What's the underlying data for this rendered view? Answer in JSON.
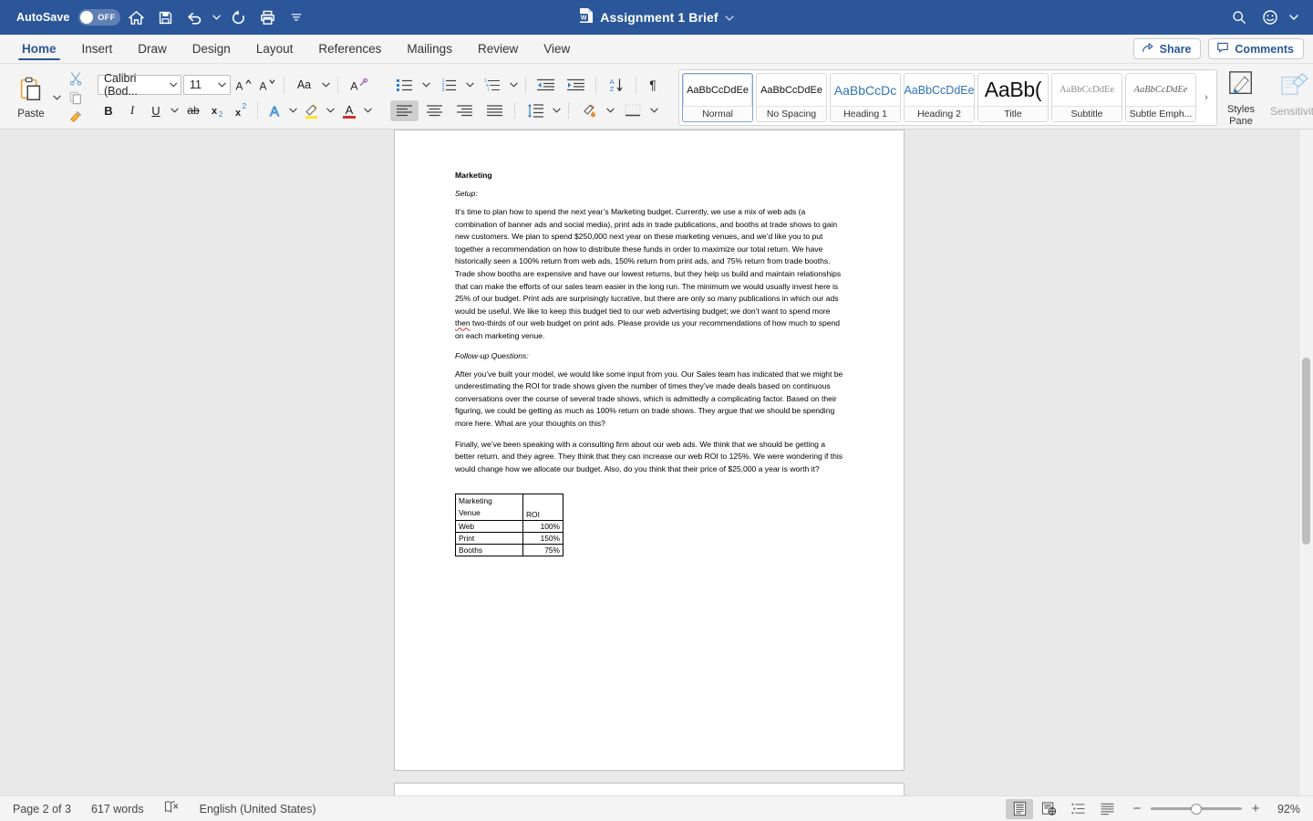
{
  "titlebar": {
    "autosave_label": "AutoSave",
    "autosave_state": "OFF",
    "doc_title": "Assignment 1 Brief",
    "icons": [
      "home-icon",
      "save-icon",
      "undo-icon",
      "redo-icon",
      "print-icon",
      "customize-toolbar-icon"
    ],
    "right_icons": [
      "search-icon",
      "account-icon"
    ],
    "accent_color": "#2b579a"
  },
  "ribbon_tabs": {
    "items": [
      {
        "label": "Home",
        "active": true
      },
      {
        "label": "Insert",
        "active": false
      },
      {
        "label": "Draw",
        "active": false
      },
      {
        "label": "Design",
        "active": false
      },
      {
        "label": "Layout",
        "active": false
      },
      {
        "label": "References",
        "active": false
      },
      {
        "label": "Mailings",
        "active": false
      },
      {
        "label": "Review",
        "active": false
      },
      {
        "label": "View",
        "active": false
      }
    ],
    "share_label": "Share",
    "comments_label": "Comments"
  },
  "ribbon": {
    "clipboard": {
      "paste_label": "Paste",
      "cut_icon": "scissors-icon",
      "copy_icon": "copy-icon",
      "format_painter_icon": "format-painter-icon"
    },
    "font": {
      "font_name": "Calibri (Bod...",
      "font_size": "11",
      "grow_font_label": "A",
      "shrink_font_label": "A",
      "change_case_label": "Aa",
      "clear_formatting_icon": "clear-formatting-icon",
      "bold_label": "B",
      "italic_label": "I",
      "underline_label": "U",
      "strikethrough_label": "ab",
      "subscript_label": "x",
      "superscript_label": "x",
      "text_effects_label": "A",
      "highlight_label": "highlight-icon",
      "font_color_label": "A"
    },
    "paragraph": {
      "bullets_icon": "bullet-list-icon",
      "numbering_icon": "numbered-list-icon",
      "multilevel_icon": "multilevel-list-icon",
      "decrease_indent_icon": "decrease-indent-icon",
      "increase_indent_icon": "increase-indent-icon",
      "sort_icon": "sort-icon",
      "show_marks_label": "¶",
      "align_left_icon": "align-left-icon",
      "align_center_icon": "align-center-icon",
      "align_right_icon": "align-right-icon",
      "justify_icon": "justify-icon",
      "line_spacing_icon": "line-spacing-icon",
      "shading_icon": "shading-icon",
      "borders_icon": "borders-icon"
    },
    "styles": {
      "items": [
        {
          "preview": "AaBbCcDdEe",
          "name": "Normal",
          "selected": true
        },
        {
          "preview": "AaBbCcDdEe",
          "name": "No Spacing",
          "selected": false
        },
        {
          "preview": "AaBbCcDc",
          "name": "Heading 1",
          "selected": false
        },
        {
          "preview": "AaBbCcDdEe",
          "name": "Heading 2",
          "selected": false
        },
        {
          "preview": "AaBb(",
          "name": "Title",
          "selected": false
        },
        {
          "preview": "AaBbCcDdEe",
          "name": "Subtitle",
          "selected": false
        },
        {
          "preview": "AaBbCcDdEe",
          "name": "Subtle Emph...",
          "selected": false
        }
      ],
      "more_label": "›",
      "styles_pane_label": "Styles\nPane",
      "styles_pane_line1": "Styles",
      "styles_pane_line2": "Pane"
    },
    "sensitivity": {
      "label": "Sensitivity",
      "icon": "sensitivity-icon"
    }
  },
  "document": {
    "heading": "Marketing",
    "setup_label": "Setup:",
    "paragraph_1_a": "It’s time to plan how to spend the next year’s Marketing budget. Currently, we use a mix of web ads (a combination of banner ads and social media), print ads in trade publications, and booths at trade shows to gain new customers. We plan to spend $250,000 next year on these marketing venues, and we’d like you to put together a recommendation on how to distribute these funds in order to maximize our total return. We have historically seen a 100% return from web ads, 150% return from print ads, and 75% return from trade booths. Trade show booths are expensive and have our lowest returns, but they help us build and maintain relationships that can make the efforts of our sales team easier in the long run. The minimum we would usually invest here is 25% of our budget. Print ads are surprisingly lucrative, but there are only so many publications in which our ads would be useful. We like to keep this budget tied to our web advertising budget; we don’t want to spend more ",
    "paragraph_1_misspelled": "then",
    "paragraph_1_b": " two-thirds of our web budget on print ads. Please provide us your recommendations of how much to spend on each marketing venue.",
    "followup_label": "Follow-up Questions:",
    "paragraph_2": "After you’ve built your model, we would like some input from you. Our Sales team has indicated that we might be underestimating the ROI for trade shows given the number of times they’ve made deals based on continuous conversations over the course of several trade shows, which is admittedly a complicating factor. Based on their figuring, we could be getting as much as 100% return on trade shows. They argue that we should be spending more here. What are your thoughts on this?",
    "paragraph_3": "Finally, we’ve been speaking with a consulting firm about our web ads. We think that we should be getting a better return, and they agree. They think that they can increase our web ROI to 125%. We were wondering if this would change how we allocate our budget. Also, do you think that their price of $25,000 a year is worth it?",
    "table": {
      "header": [
        "Marketing Venue",
        "ROI"
      ],
      "header_line1": "Marketing",
      "header_line2": "Venue",
      "rows": [
        {
          "venue": "Web",
          "roi": "100%"
        },
        {
          "venue": "Print",
          "roi": "150%"
        },
        {
          "venue": "Booths",
          "roi": "75%"
        }
      ]
    }
  },
  "statusbar": {
    "page_label": "Page 2 of 3",
    "word_count": "617 words",
    "proofing_icon": "proofing-errors-icon",
    "language": "English (United States)",
    "views": [
      {
        "name": "print-layout-view",
        "active": true
      },
      {
        "name": "web-layout-view",
        "active": false
      },
      {
        "name": "outline-view",
        "active": false
      },
      {
        "name": "draft-view",
        "active": false
      }
    ],
    "zoom_out_label": "−",
    "zoom_in_label": "+",
    "zoom_value": "92%"
  }
}
